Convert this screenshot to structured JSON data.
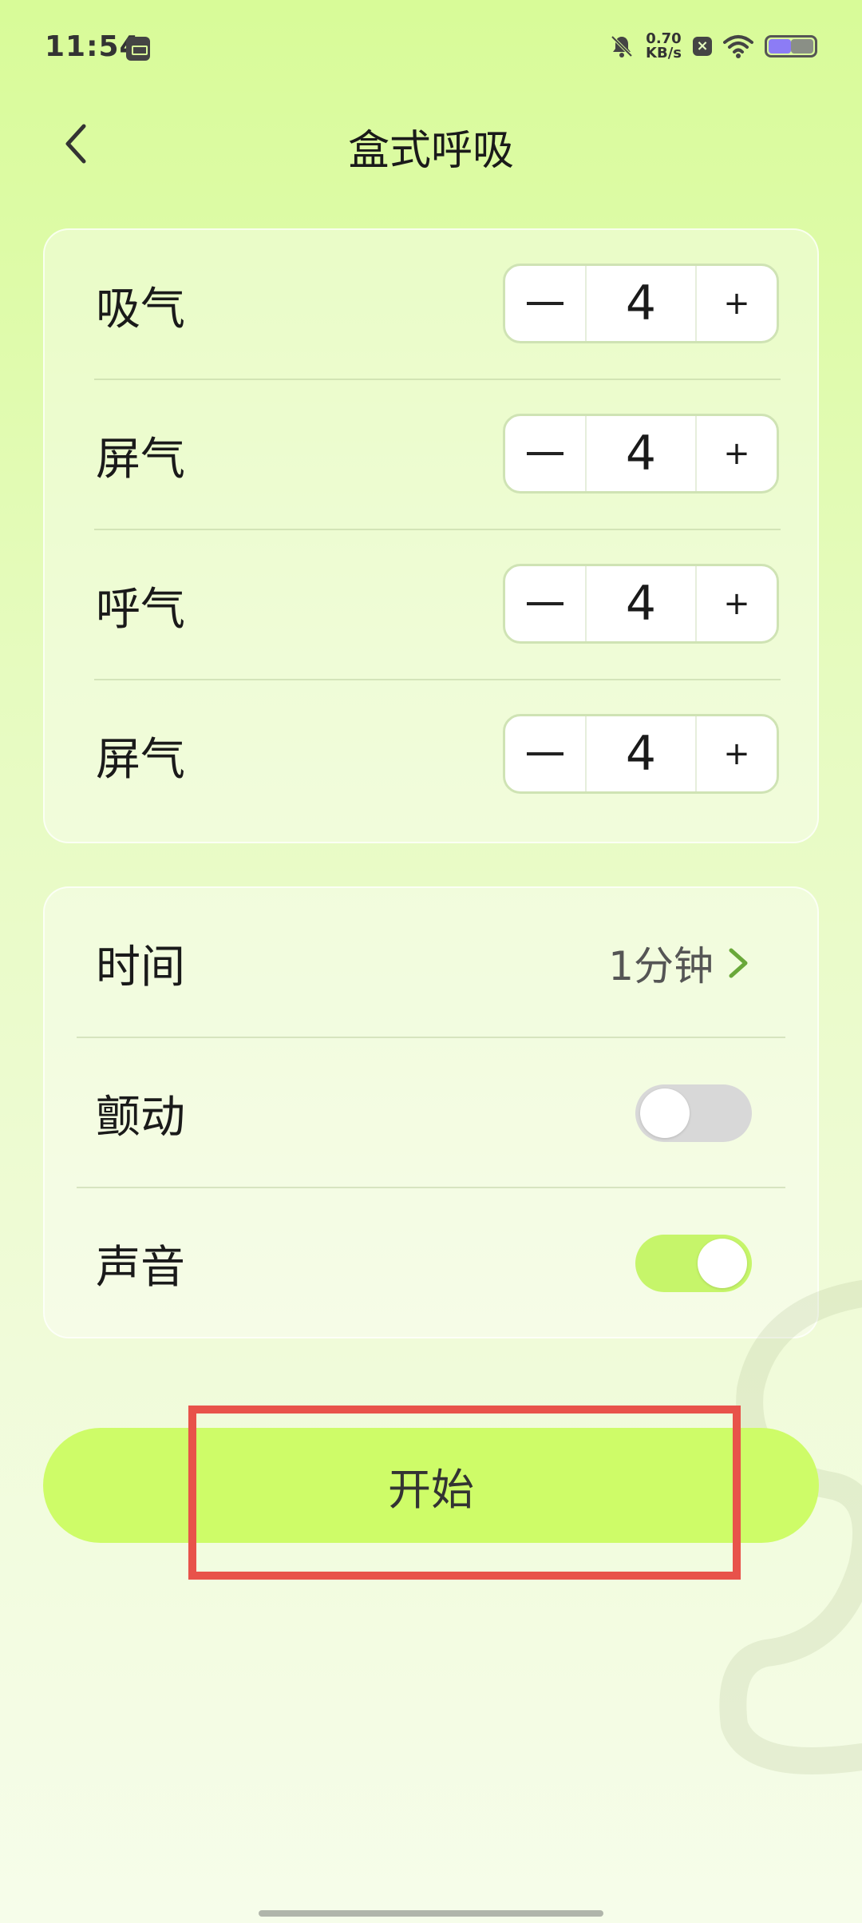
{
  "status_bar": {
    "time": "11:54",
    "net_speed_value": "0.70",
    "net_speed_unit": "KB/s",
    "badge": "×"
  },
  "header": {
    "title": "盒式呼吸"
  },
  "phases": [
    {
      "label": "吸气",
      "value": "4",
      "plus": "+"
    },
    {
      "label": "屏气",
      "value": "4",
      "plus": "+"
    },
    {
      "label": "呼气",
      "value": "4",
      "plus": "+"
    },
    {
      "label": "屏气",
      "value": "4",
      "plus": "+"
    }
  ],
  "settings": {
    "time": {
      "label": "时间",
      "value": "1分钟"
    },
    "vibration": {
      "label": "颤动",
      "enabled": false
    },
    "sound": {
      "label": "声音",
      "enabled": true
    }
  },
  "start_button": {
    "label": "开始"
  },
  "colors": {
    "accent": "#cefc68",
    "toggle_on": "#c6f56a",
    "toggle_off": "#d8d8d8",
    "highlight": "#e8524a",
    "chevron": "#6aa83a"
  }
}
